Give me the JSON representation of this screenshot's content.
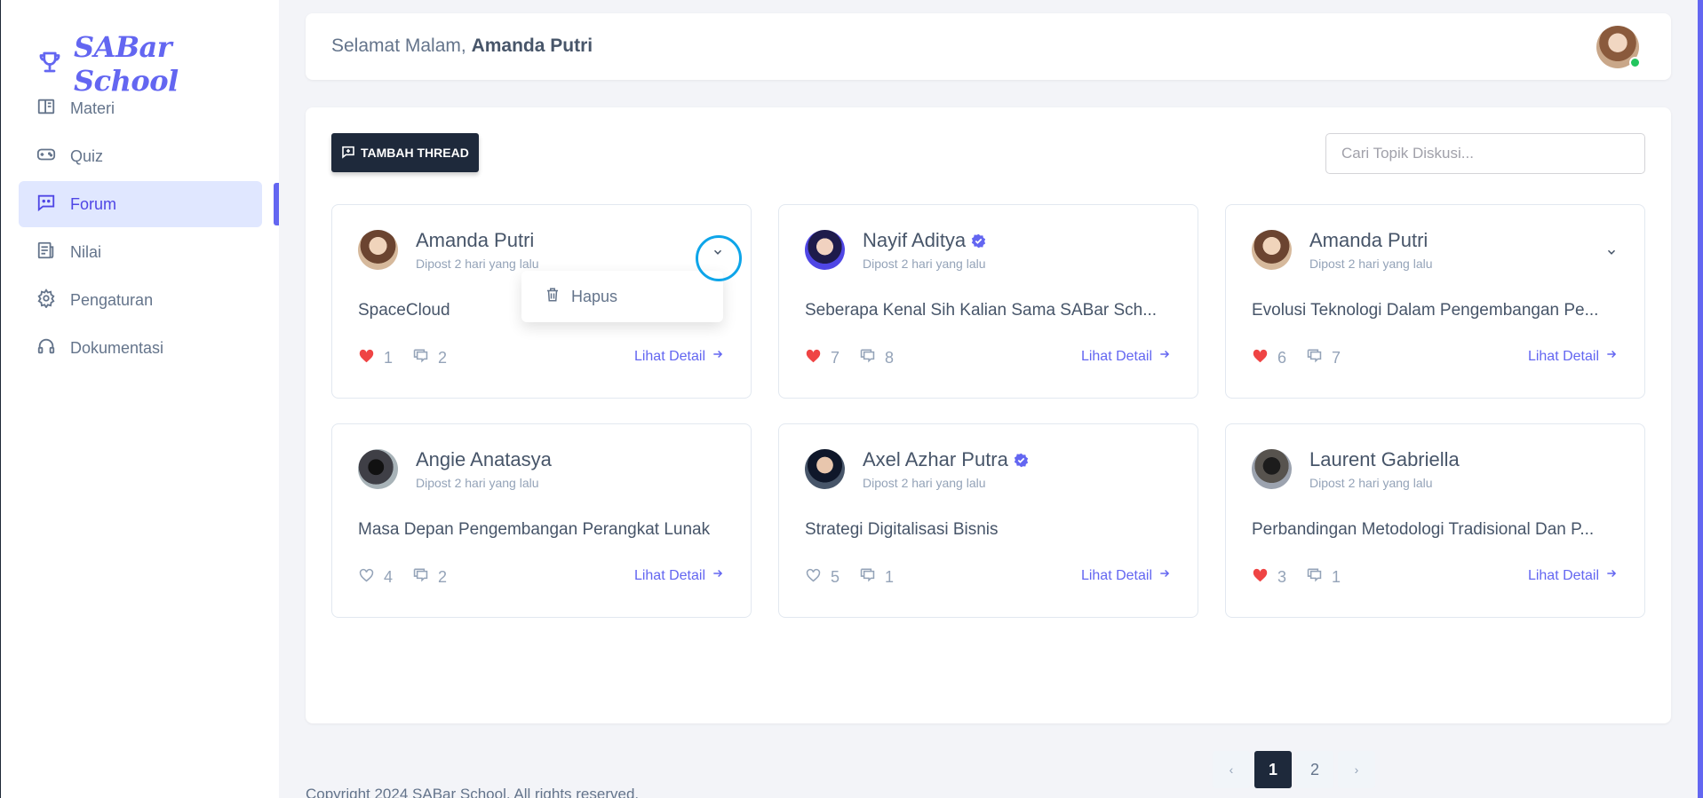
{
  "app": {
    "brand": "SABar School"
  },
  "sidebar": {
    "items": [
      {
        "label": "Materi",
        "icon": "book-icon"
      },
      {
        "label": "Quiz",
        "icon": "gamepad-icon"
      },
      {
        "label": "Forum",
        "icon": "chat-icon",
        "active": true
      },
      {
        "label": "Nilai",
        "icon": "report-icon"
      },
      {
        "label": "Pengaturan",
        "icon": "gear-icon"
      },
      {
        "label": "Dokumentasi",
        "icon": "headset-icon"
      }
    ]
  },
  "header": {
    "greeting": "Selamat Malam,",
    "user_name": "Amanda Putri"
  },
  "forum": {
    "add_thread_label": "TAMBAH THREAD",
    "search_placeholder": "Cari Topik Diskusi...",
    "detail_label": "Lihat Detail",
    "threads": [
      {
        "author": "Amanda Putri",
        "verified": false,
        "time": "Dipost 2 hari yang lalu",
        "title": "SpaceCloud",
        "likes": "1",
        "liked": true,
        "comments": "2",
        "owner": true
      },
      {
        "author": "Nayif Aditya",
        "verified": true,
        "time": "Dipost 2 hari yang lalu",
        "title": "Seberapa Kenal Sih Kalian Sama SABar Sch...",
        "likes": "7",
        "liked": true,
        "comments": "8",
        "owner": false
      },
      {
        "author": "Amanda Putri",
        "verified": false,
        "time": "Dipost 2 hari yang lalu",
        "title": "Evolusi Teknologi Dalam Pengembangan Pe...",
        "likes": "6",
        "liked": true,
        "comments": "7",
        "owner": true
      },
      {
        "author": "Angie Anatasya",
        "verified": false,
        "time": "Dipost 2 hari yang lalu",
        "title": "Masa Depan Pengembangan Perangkat Lunak",
        "likes": "4",
        "liked": false,
        "comments": "2",
        "owner": false
      },
      {
        "author": "Axel Azhar Putra",
        "verified": true,
        "time": "Dipost 2 hari yang lalu",
        "title": "Strategi Digitalisasi Bisnis",
        "likes": "5",
        "liked": false,
        "comments": "1",
        "owner": false
      },
      {
        "author": "Laurent Gabriella",
        "verified": false,
        "time": "Dipost 2 hari yang lalu",
        "title": "Perbandingan Metodologi Tradisional Dan P...",
        "likes": "3",
        "liked": true,
        "comments": "1",
        "owner": false
      }
    ],
    "dropdown": {
      "delete_label": "Hapus"
    }
  },
  "pagination": {
    "prev": "‹",
    "pages": [
      "1",
      "2"
    ],
    "current": "1",
    "next": "›"
  },
  "footer": {
    "text": "Copyright 2024 SABar School. All rights reserved."
  },
  "colors": {
    "accent": "#6366f1",
    "dark": "#1e293b",
    "heart": "#ef4444"
  }
}
